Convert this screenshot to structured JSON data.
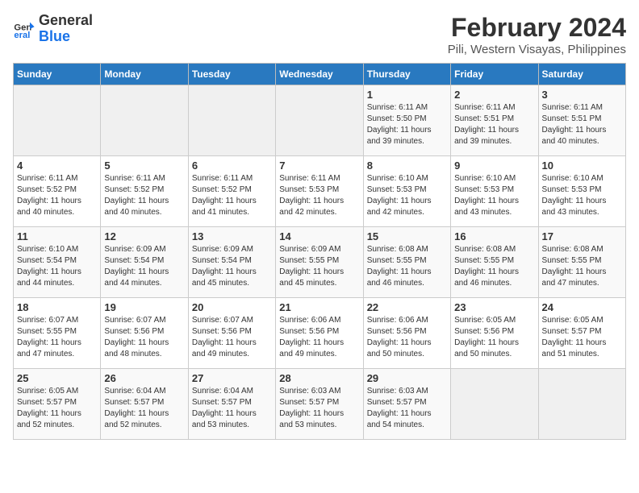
{
  "logo": {
    "line1": "General",
    "line2": "Blue"
  },
  "title": "February 2024",
  "subtitle": "Pili, Western Visayas, Philippines",
  "days_of_week": [
    "Sunday",
    "Monday",
    "Tuesday",
    "Wednesday",
    "Thursday",
    "Friday",
    "Saturday"
  ],
  "weeks": [
    [
      {
        "day": "",
        "info": ""
      },
      {
        "day": "",
        "info": ""
      },
      {
        "day": "",
        "info": ""
      },
      {
        "day": "",
        "info": ""
      },
      {
        "day": "1",
        "info": "Sunrise: 6:11 AM\nSunset: 5:50 PM\nDaylight: 11 hours\nand 39 minutes."
      },
      {
        "day": "2",
        "info": "Sunrise: 6:11 AM\nSunset: 5:51 PM\nDaylight: 11 hours\nand 39 minutes."
      },
      {
        "day": "3",
        "info": "Sunrise: 6:11 AM\nSunset: 5:51 PM\nDaylight: 11 hours\nand 40 minutes."
      }
    ],
    [
      {
        "day": "4",
        "info": "Sunrise: 6:11 AM\nSunset: 5:52 PM\nDaylight: 11 hours\nand 40 minutes."
      },
      {
        "day": "5",
        "info": "Sunrise: 6:11 AM\nSunset: 5:52 PM\nDaylight: 11 hours\nand 40 minutes."
      },
      {
        "day": "6",
        "info": "Sunrise: 6:11 AM\nSunset: 5:52 PM\nDaylight: 11 hours\nand 41 minutes."
      },
      {
        "day": "7",
        "info": "Sunrise: 6:11 AM\nSunset: 5:53 PM\nDaylight: 11 hours\nand 42 minutes."
      },
      {
        "day": "8",
        "info": "Sunrise: 6:10 AM\nSunset: 5:53 PM\nDaylight: 11 hours\nand 42 minutes."
      },
      {
        "day": "9",
        "info": "Sunrise: 6:10 AM\nSunset: 5:53 PM\nDaylight: 11 hours\nand 43 minutes."
      },
      {
        "day": "10",
        "info": "Sunrise: 6:10 AM\nSunset: 5:53 PM\nDaylight: 11 hours\nand 43 minutes."
      }
    ],
    [
      {
        "day": "11",
        "info": "Sunrise: 6:10 AM\nSunset: 5:54 PM\nDaylight: 11 hours\nand 44 minutes."
      },
      {
        "day": "12",
        "info": "Sunrise: 6:09 AM\nSunset: 5:54 PM\nDaylight: 11 hours\nand 44 minutes."
      },
      {
        "day": "13",
        "info": "Sunrise: 6:09 AM\nSunset: 5:54 PM\nDaylight: 11 hours\nand 45 minutes."
      },
      {
        "day": "14",
        "info": "Sunrise: 6:09 AM\nSunset: 5:55 PM\nDaylight: 11 hours\nand 45 minutes."
      },
      {
        "day": "15",
        "info": "Sunrise: 6:08 AM\nSunset: 5:55 PM\nDaylight: 11 hours\nand 46 minutes."
      },
      {
        "day": "16",
        "info": "Sunrise: 6:08 AM\nSunset: 5:55 PM\nDaylight: 11 hours\nand 46 minutes."
      },
      {
        "day": "17",
        "info": "Sunrise: 6:08 AM\nSunset: 5:55 PM\nDaylight: 11 hours\nand 47 minutes."
      }
    ],
    [
      {
        "day": "18",
        "info": "Sunrise: 6:07 AM\nSunset: 5:55 PM\nDaylight: 11 hours\nand 47 minutes."
      },
      {
        "day": "19",
        "info": "Sunrise: 6:07 AM\nSunset: 5:56 PM\nDaylight: 11 hours\nand 48 minutes."
      },
      {
        "day": "20",
        "info": "Sunrise: 6:07 AM\nSunset: 5:56 PM\nDaylight: 11 hours\nand 49 minutes."
      },
      {
        "day": "21",
        "info": "Sunrise: 6:06 AM\nSunset: 5:56 PM\nDaylight: 11 hours\nand 49 minutes."
      },
      {
        "day": "22",
        "info": "Sunrise: 6:06 AM\nSunset: 5:56 PM\nDaylight: 11 hours\nand 50 minutes."
      },
      {
        "day": "23",
        "info": "Sunrise: 6:05 AM\nSunset: 5:56 PM\nDaylight: 11 hours\nand 50 minutes."
      },
      {
        "day": "24",
        "info": "Sunrise: 6:05 AM\nSunset: 5:57 PM\nDaylight: 11 hours\nand 51 minutes."
      }
    ],
    [
      {
        "day": "25",
        "info": "Sunrise: 6:05 AM\nSunset: 5:57 PM\nDaylight: 11 hours\nand 52 minutes."
      },
      {
        "day": "26",
        "info": "Sunrise: 6:04 AM\nSunset: 5:57 PM\nDaylight: 11 hours\nand 52 minutes."
      },
      {
        "day": "27",
        "info": "Sunrise: 6:04 AM\nSunset: 5:57 PM\nDaylight: 11 hours\nand 53 minutes."
      },
      {
        "day": "28",
        "info": "Sunrise: 6:03 AM\nSunset: 5:57 PM\nDaylight: 11 hours\nand 53 minutes."
      },
      {
        "day": "29",
        "info": "Sunrise: 6:03 AM\nSunset: 5:57 PM\nDaylight: 11 hours\nand 54 minutes."
      },
      {
        "day": "",
        "info": ""
      },
      {
        "day": "",
        "info": ""
      }
    ]
  ]
}
